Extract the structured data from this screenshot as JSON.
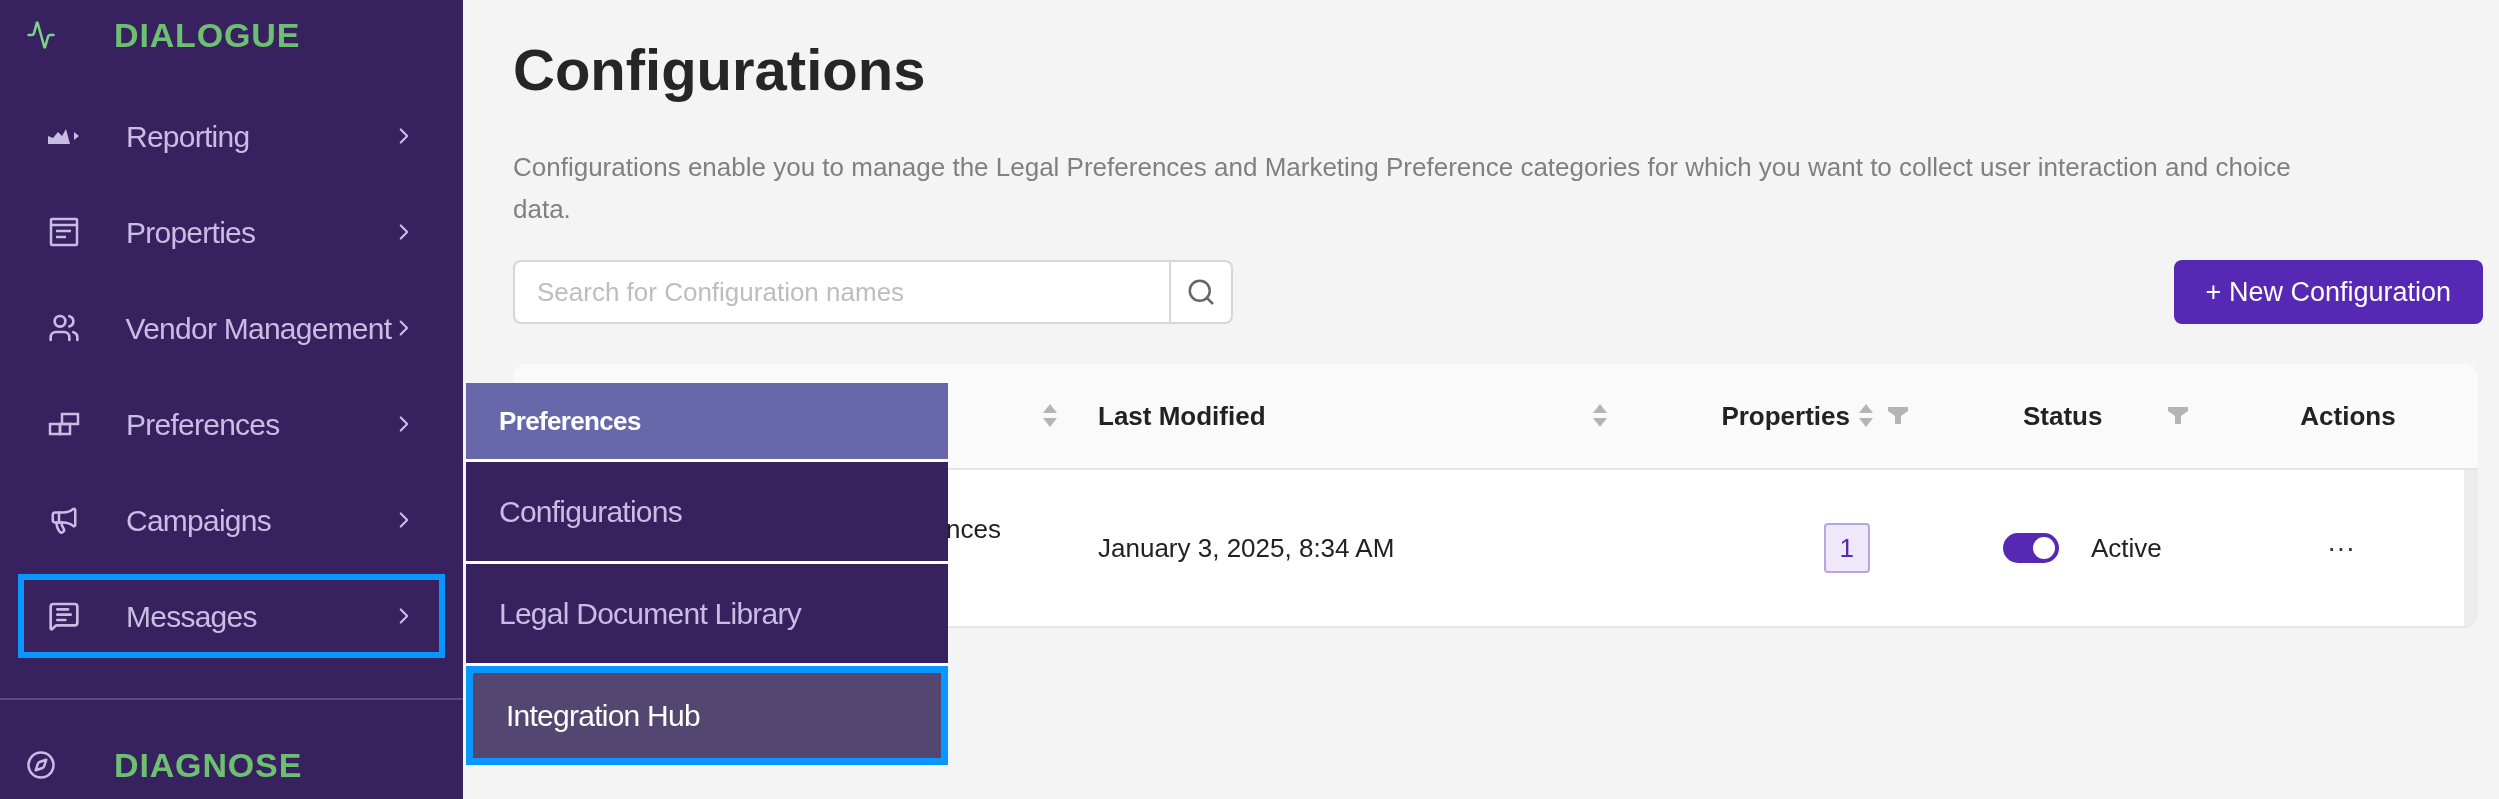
{
  "sidebar": {
    "sections": [
      {
        "title": "DIALOGUE",
        "items": [
          {
            "label": "Reporting",
            "focused": false
          },
          {
            "label": "Properties",
            "focused": false
          },
          {
            "label": "Vendor Management",
            "focused": false
          },
          {
            "label": "Preferences",
            "focused": false
          },
          {
            "label": "Campaigns",
            "focused": false
          },
          {
            "label": "Messages",
            "focused": true
          }
        ]
      },
      {
        "title": "DIAGNOSE"
      }
    ]
  },
  "flyout": {
    "title": "Preferences",
    "items": [
      {
        "label": "Configurations",
        "focused": false
      },
      {
        "label": "Legal Document Library",
        "focused": false
      },
      {
        "label": "Integration Hub",
        "focused": true
      }
    ]
  },
  "page": {
    "title": "Configurations",
    "description": "Configurations enable you to manage the Legal Preferences and Marketing Preference categories for which you want to collect user interaction and choice data.",
    "search": {
      "placeholder": "Search for Configuration names"
    },
    "new_button": "+ New Configuration"
  },
  "table": {
    "columns": [
      {
        "sortable": true,
        "filterable": false
      },
      {
        "label": "Last Modified",
        "sortable": true,
        "filterable": false
      },
      {
        "label": "Properties",
        "sortable": true,
        "filterable": true
      },
      {
        "label": "Status",
        "sortable": false,
        "filterable": true
      },
      {
        "label": "Actions",
        "sortable": false,
        "filterable": false
      }
    ],
    "rows": [
      {
        "column_1": "nces",
        "last_modified": "January 3, 2025, 8:34 AM",
        "properties": "1",
        "status": {
          "on": true,
          "label": "Active"
        },
        "actions": "···"
      }
    ]
  }
}
